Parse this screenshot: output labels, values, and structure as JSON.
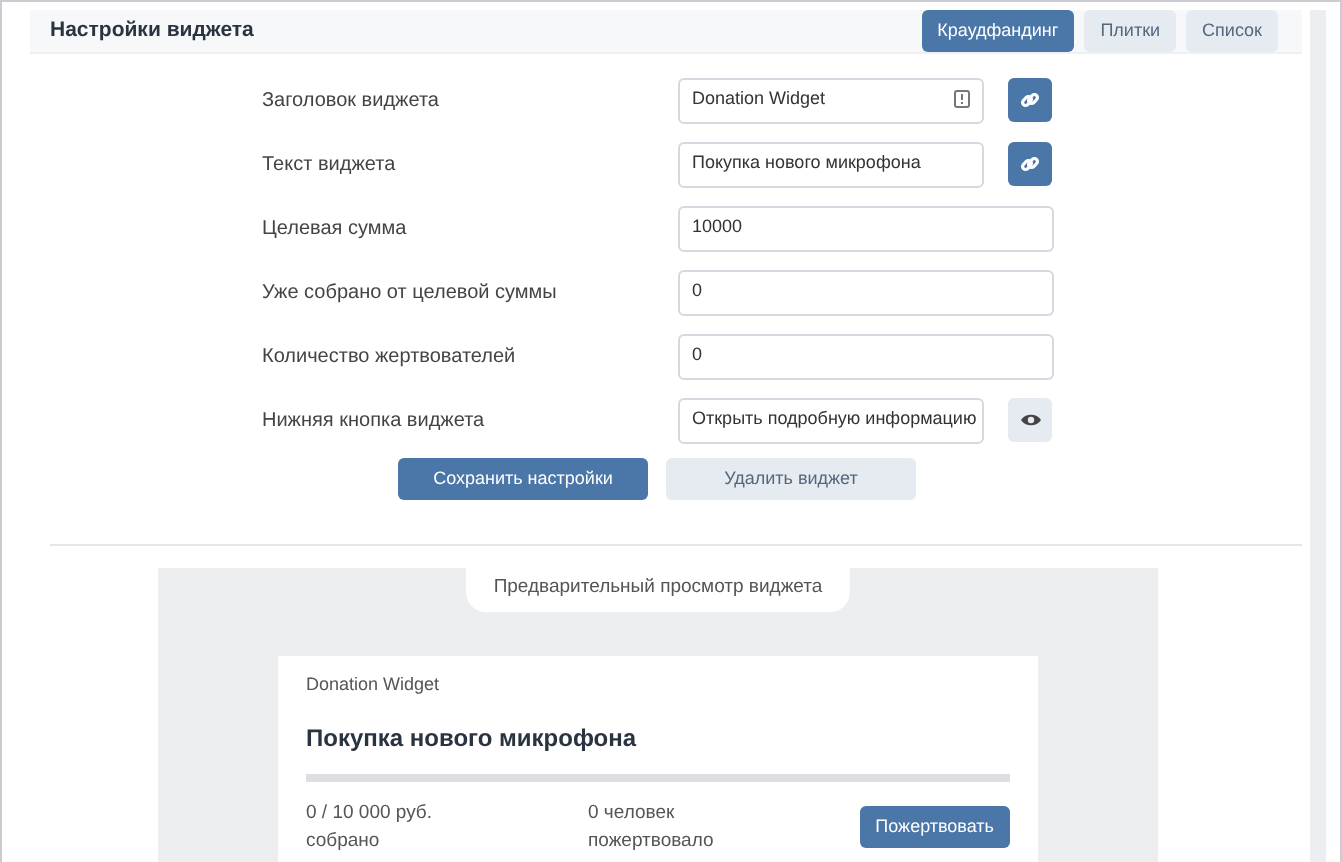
{
  "header": {
    "title": "Настройки виджета",
    "tabs": [
      {
        "label": "Краудфандинг",
        "selected": true
      },
      {
        "label": "Плитки",
        "selected": false
      },
      {
        "label": "Список",
        "selected": false
      }
    ]
  },
  "fields": [
    {
      "label": "Заголовок виджета",
      "value": "Donation Widget",
      "kind": "link",
      "counter": true
    },
    {
      "label": "Текст виджета",
      "value": "Покупка нового микрофона",
      "kind": "link",
      "counter": false
    },
    {
      "label": "Целевая сумма",
      "value": "10000",
      "kind": "plain",
      "counter": false
    },
    {
      "label": "Уже собрано от целевой суммы",
      "value": "0",
      "kind": "plain",
      "counter": false
    },
    {
      "label": "Количество жертвователей",
      "value": "0",
      "kind": "plain",
      "counter": false
    },
    {
      "label": "Нижняя кнопка виджета",
      "value": "Открыть подробную информацию",
      "kind": "eye",
      "counter": false
    }
  ],
  "actions": {
    "save": "Сохранить настройки",
    "delete": "Удалить виджет"
  },
  "preview": {
    "caption": "Предварительный просмотр виджета",
    "widget_title": "Donation Widget",
    "text": "Покупка нового микрофона",
    "level": 0,
    "collected": "0 / 10 000 руб.",
    "collected_note": "собрано",
    "donors": "0 человек",
    "donors_note": "пожертвовало",
    "button": "Пожертвовать"
  }
}
